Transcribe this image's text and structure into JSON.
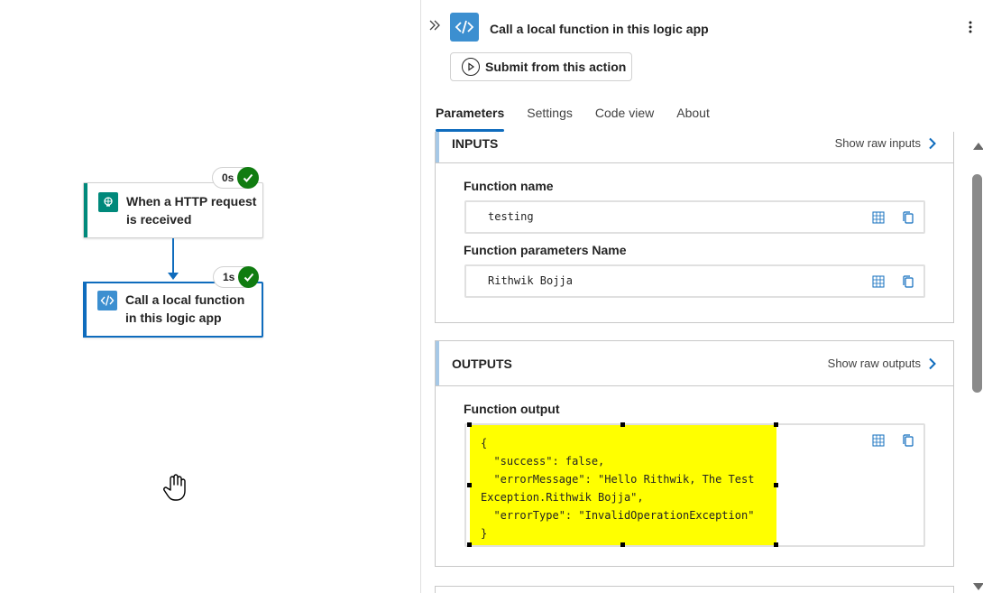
{
  "canvas": {
    "trigger_node": {
      "title": "When a HTTP request is received",
      "duration": "0s",
      "icon": "http-request-icon"
    },
    "action_node": {
      "title": "Call a local function in this logic app",
      "duration": "1s",
      "icon": "code-icon"
    },
    "status_color": "#107c10",
    "accent_color": "#0f6cbd",
    "cursor_icon": "hand-cursor-icon"
  },
  "panel": {
    "title": "Call a local function in this logic app",
    "submit_label": "Submit from this action",
    "tabs": [
      {
        "label": "Parameters",
        "active": true
      },
      {
        "label": "Settings",
        "active": false
      },
      {
        "label": "Code view",
        "active": false
      },
      {
        "label": "About",
        "active": false
      }
    ],
    "inputs": {
      "heading": "INPUTS",
      "raw_label": "Show raw inputs",
      "fields": [
        {
          "label": "Function name",
          "value": "testing"
        },
        {
          "label": "Function parameters Name",
          "value": "Rithwik Bojja"
        }
      ]
    },
    "outputs": {
      "heading": "OUTPUTS",
      "raw_label": "Show raw outputs",
      "field_label": "Function output",
      "code_lines": [
        "{",
        "  \"success\": false,",
        "  \"errorMessage\": \"Hello Rithwik, The Test",
        "Exception.Rithwik Bojja\",",
        "  \"errorType\": \"InvalidOperationException\"",
        "}"
      ],
      "highlight_color": "#ffff00"
    }
  }
}
